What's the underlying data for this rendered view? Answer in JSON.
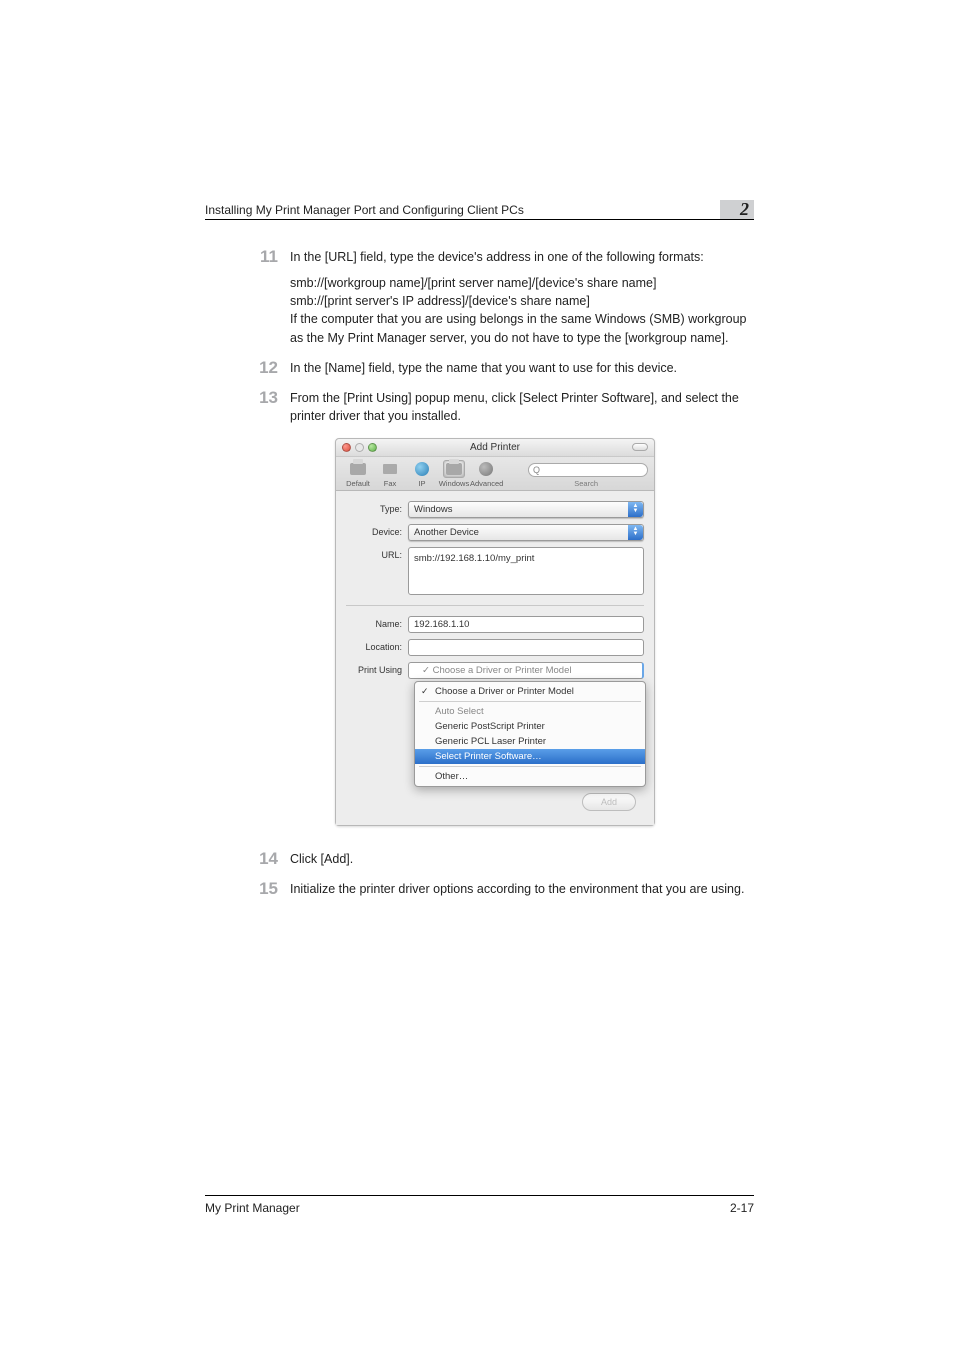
{
  "header": {
    "title": "Installing My Print Manager Port and Configuring Client PCs",
    "chapter": "2"
  },
  "steps": [
    {
      "num": "11",
      "paras": [
        "In the [URL] field, type the device's address in one of the following formats:",
        "smb://[workgroup name]/[print server name]/[device's share name]\nsmb://[print server's IP address]/[device's share name]\nIf the computer that you are using belongs in the same Windows (SMB) workgroup as the My Print Manager server, you do not have to type the [workgroup name]."
      ]
    },
    {
      "num": "12",
      "paras": [
        "In the [Name] field, type the name that you want to use for this device."
      ]
    },
    {
      "num": "13",
      "paras": [
        "From the [Print Using] popup menu, click [Select Printer Software], and select the printer driver that you installed."
      ]
    },
    {
      "num": "14",
      "paras": [
        "Click [Add]."
      ]
    },
    {
      "num": "15",
      "paras": [
        "Initialize the printer driver options according to the environment that you are using."
      ]
    }
  ],
  "mac": {
    "title": "Add Printer",
    "toolbar": {
      "items": [
        "Default",
        "Fax",
        "IP",
        "Windows",
        "Advanced"
      ],
      "search_glyph": "Q",
      "search_label": "Search"
    },
    "form": {
      "type_label": "Type:",
      "type_value": "Windows",
      "device_label": "Device:",
      "device_value": "Another Device",
      "url_label": "URL:",
      "url_value": "smb://192.168.1.10/my_print",
      "name_label": "Name:",
      "name_value": "192.168.1.10",
      "location_label": "Location:",
      "location_value": "",
      "print_using_label": "Print Using",
      "print_using_value": "Choose a Driver or Printer Model"
    },
    "menu": {
      "items": [
        {
          "label": "Choose a Driver or Printer Model",
          "checked": true
        },
        {
          "sep": true
        },
        {
          "label": "Auto Select",
          "muted": true
        },
        {
          "label": "Generic PostScript Printer"
        },
        {
          "label": "Generic PCL Laser Printer"
        },
        {
          "label": "Select Printer Software…",
          "selected": true
        },
        {
          "sep": true
        },
        {
          "label": "Other…"
        }
      ]
    },
    "add_button": "Add"
  },
  "footer": {
    "left": "My Print Manager",
    "right": "2-17"
  }
}
